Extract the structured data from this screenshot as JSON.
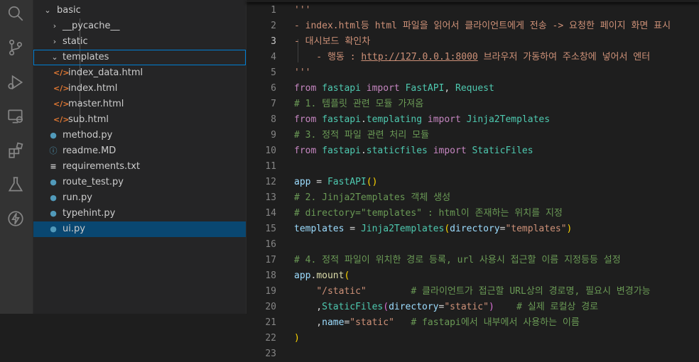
{
  "activity_bar": [
    "search-icon",
    "source-control-icon",
    "run-debug-icon",
    "remote-explorer-icon",
    "extensions-icon",
    "testing-icon",
    "thunder-client-icon"
  ],
  "explorer": {
    "items": [
      {
        "label": "basic",
        "type": "folder-open",
        "level": 0
      },
      {
        "label": "__pycache__",
        "type": "folder",
        "level": 1
      },
      {
        "label": "static",
        "type": "folder",
        "level": 1
      },
      {
        "label": "templates",
        "type": "folder-open",
        "level": 1
      },
      {
        "label": "index_data.html",
        "type": "html",
        "level": 2
      },
      {
        "label": "index.html",
        "type": "html",
        "level": 2
      },
      {
        "label": "master.html",
        "type": "html",
        "level": 2
      },
      {
        "label": "sub.html",
        "type": "html",
        "level": 2
      },
      {
        "label": "method.py",
        "type": "python",
        "level": 1
      },
      {
        "label": "readme.MD",
        "type": "info",
        "level": 1
      },
      {
        "label": "requirements.txt",
        "type": "text",
        "level": 1
      },
      {
        "label": "route_test.py",
        "type": "python",
        "level": 1
      },
      {
        "label": "run.py",
        "type": "python",
        "level": 1
      },
      {
        "label": "typehint.py",
        "type": "python",
        "level": 1
      },
      {
        "label": "ui.py",
        "type": "python",
        "level": 1
      }
    ]
  },
  "editor": {
    "active_line": 3,
    "lines": [
      {
        "n": "1",
        "t": [
          [
            "md",
            "'''"
          ]
        ]
      },
      {
        "n": "2",
        "t": [
          [
            "md",
            "- index.html등 html 파일을 읽어서 클라이언트에게 전송 -> 요청한 페이지 화면 표시"
          ]
        ]
      },
      {
        "n": "3",
        "t": [
          [
            "md",
            "- 대시보드 확인차"
          ]
        ]
      },
      {
        "n": "4",
        "t": [
          [
            "md",
            "    - 행동 : "
          ],
          [
            "link",
            "http://127.0.0.1:8000"
          ],
          [
            "md",
            " 브라우저 가동하여 주소창에 넣어서 엔터"
          ]
        ]
      },
      {
        "n": "5",
        "t": [
          [
            "md",
            "'''"
          ]
        ]
      },
      {
        "n": "6",
        "t": [
          [
            "kw",
            "from"
          ],
          [
            "pl",
            " "
          ],
          [
            "mod",
            "fastapi"
          ],
          [
            "pl",
            " "
          ],
          [
            "kw",
            "import"
          ],
          [
            "pl",
            " "
          ],
          [
            "cls",
            "FastAPI"
          ],
          [
            "pl",
            ", "
          ],
          [
            "cls",
            "Request"
          ]
        ]
      },
      {
        "n": "7",
        "t": [
          [
            "com",
            "# 1. 템플릿 관련 모듈 가져옴"
          ]
        ]
      },
      {
        "n": "8",
        "t": [
          [
            "kw",
            "from"
          ],
          [
            "pl",
            " "
          ],
          [
            "mod",
            "fastapi"
          ],
          [
            "pl",
            "."
          ],
          [
            "mod",
            "templating"
          ],
          [
            "pl",
            " "
          ],
          [
            "kw",
            "import"
          ],
          [
            "pl",
            " "
          ],
          [
            "cls",
            "Jinja2Templates"
          ]
        ]
      },
      {
        "n": "9",
        "t": [
          [
            "com",
            "# 3. 정적 파일 관련 처리 모듈"
          ]
        ]
      },
      {
        "n": "10",
        "t": [
          [
            "kw",
            "from"
          ],
          [
            "pl",
            " "
          ],
          [
            "mod",
            "fastapi"
          ],
          [
            "pl",
            "."
          ],
          [
            "mod",
            "staticfiles"
          ],
          [
            "pl",
            " "
          ],
          [
            "kw",
            "import"
          ],
          [
            "pl",
            " "
          ],
          [
            "cls",
            "StaticFiles"
          ]
        ]
      },
      {
        "n": "11",
        "t": []
      },
      {
        "n": "12",
        "t": [
          [
            "var",
            "app"
          ],
          [
            "pl",
            " = "
          ],
          [
            "cls",
            "FastAPI"
          ],
          [
            "br",
            "()"
          ]
        ]
      },
      {
        "n": "13",
        "t": [
          [
            "com",
            "# 2. Jinja2Templates 객체 생성"
          ]
        ]
      },
      {
        "n": "14",
        "t": [
          [
            "com",
            "# directory=\"templates\" : html이 존재하는 위치를 지정"
          ]
        ]
      },
      {
        "n": "15",
        "t": [
          [
            "var",
            "templates"
          ],
          [
            "pl",
            " = "
          ],
          [
            "cls",
            "Jinja2Templates"
          ],
          [
            "br",
            "("
          ],
          [
            "var",
            "directory"
          ],
          [
            "pl",
            "="
          ],
          [
            "str",
            "\"templates\""
          ],
          [
            "br",
            ")"
          ]
        ]
      },
      {
        "n": "16",
        "t": []
      },
      {
        "n": "17",
        "t": [
          [
            "com",
            "# 4. 정적 파일이 위치한 경로 등록, url 사용시 접근할 이름 지정등등 설정"
          ]
        ]
      },
      {
        "n": "18",
        "t": [
          [
            "var",
            "app"
          ],
          [
            "pl",
            "."
          ],
          [
            "fn",
            "mount"
          ],
          [
            "br",
            "("
          ]
        ]
      },
      {
        "n": "19",
        "t": [
          [
            "pl",
            "    "
          ],
          [
            "str",
            "\"/static\""
          ],
          [
            "pl",
            "        "
          ],
          [
            "com",
            "# 클라이언트가 접근할 URL상의 경로명, 필요시 변경가능"
          ]
        ]
      },
      {
        "n": "20",
        "t": [
          [
            "pl",
            "    ,"
          ],
          [
            "cls",
            "StaticFiles"
          ],
          [
            "br2",
            "("
          ],
          [
            "var",
            "directory"
          ],
          [
            "pl",
            "="
          ],
          [
            "str",
            "\"static\""
          ],
          [
            "br2",
            ")"
          ],
          [
            "pl",
            "    "
          ],
          [
            "com",
            "# 실제 로컬상 경로"
          ]
        ]
      },
      {
        "n": "21",
        "t": [
          [
            "pl",
            "    ,"
          ],
          [
            "var",
            "name"
          ],
          [
            "pl",
            "="
          ],
          [
            "str",
            "\"static\""
          ],
          [
            "pl",
            "   "
          ],
          [
            "com",
            "# fastapi에서 내부에서 사용하는 이름"
          ]
        ]
      },
      {
        "n": "22",
        "t": [
          [
            "br",
            ")"
          ]
        ]
      },
      {
        "n": "23",
        "t": []
      }
    ]
  }
}
